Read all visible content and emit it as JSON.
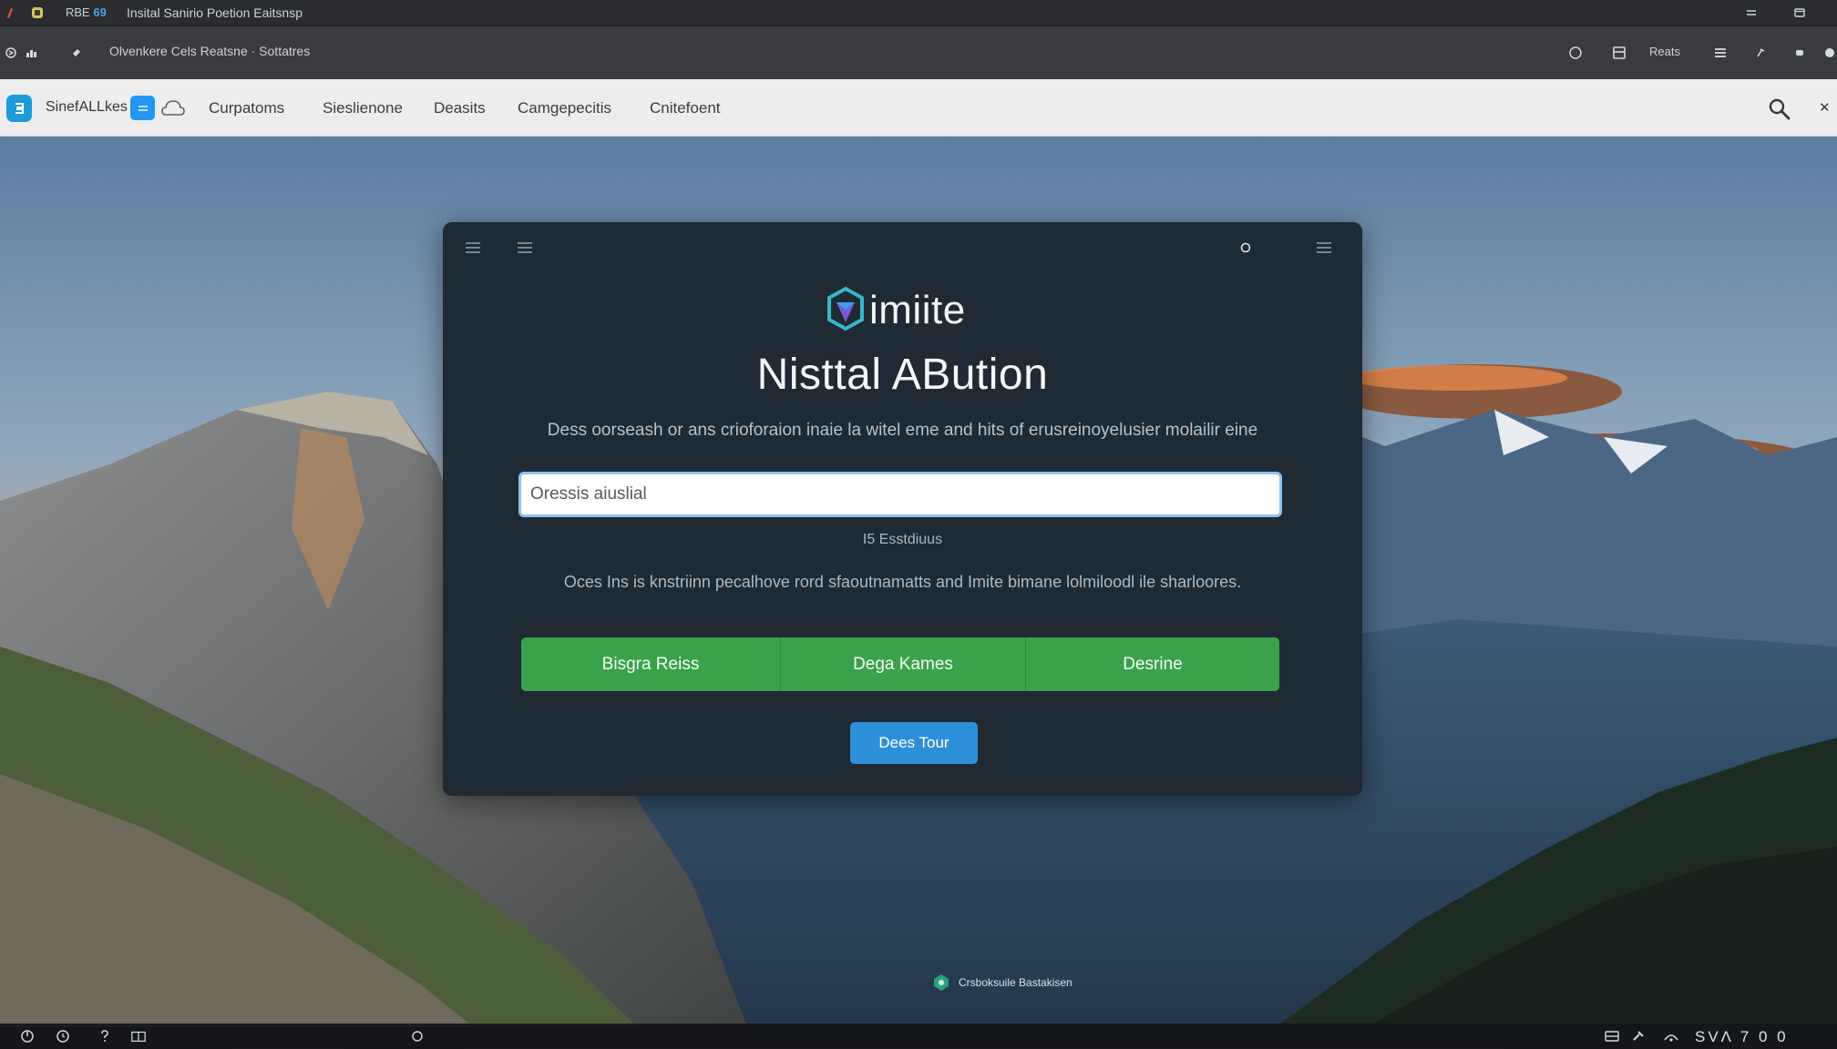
{
  "titlebar": {
    "app_tag_prefix": "RBE",
    "app_tag_number": "69",
    "title": "Insital Sanirio Poetion Eaitsnsp",
    "controls": [
      "minimize-icon",
      "restore-icon"
    ]
  },
  "browser": {
    "address_text": "Olvenkere Cels  Reatsne · Sottatres",
    "right_label": "Reats"
  },
  "site_nav": {
    "brand": "SinefALLkes",
    "links": [
      "Curpatoms",
      "Sieslienone",
      "Deasits",
      "Camgepecitis",
      "Cnitefoent"
    ]
  },
  "dialog": {
    "brand_name": "imiite",
    "title": "Nisttal ABution",
    "description": "Dess oorseash or ans crioforaion inaie la witel eme and hits of erusreinoyelusier molailir eine",
    "input_value": "Oressis aiuslial",
    "hint": "I5 Esstdiuus",
    "description_2": "Oces Ins is knstriinn pecalhove rord sfaoutnamatts and Imite bimane lolmiloodl ile sharloores.",
    "button_group": [
      "Bisgra Reiss",
      "Dega Kames",
      "Desrine"
    ],
    "primary_button": "Dees Tour"
  },
  "credit": {
    "text": "Crsboksuile Bastakisen"
  },
  "taskbar": {
    "right_text": "SVΛ 7 0 0"
  },
  "colors": {
    "dialog_bg": "#1f2a33",
    "green": "#3ba24c",
    "blue": "#2e8fd9",
    "nav_bg": "#ededee"
  }
}
